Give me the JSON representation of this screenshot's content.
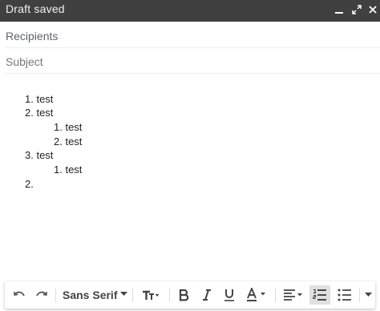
{
  "window": {
    "title": "Draft saved"
  },
  "fields": {
    "recipients_placeholder": "Recipients",
    "subject_placeholder": "Subject"
  },
  "body": {
    "items": [
      {
        "marker": "1.",
        "text": "test"
      },
      {
        "marker": "2.",
        "text": "test"
      },
      {
        "marker": "1.",
        "text": "test"
      },
      {
        "marker": "2.",
        "text": "test"
      },
      {
        "marker": "3.",
        "text": "test"
      },
      {
        "marker": "1.",
        "text": "test"
      },
      {
        "marker": "2.",
        "text": ""
      }
    ]
  },
  "toolbar": {
    "font_family": "Sans Serif",
    "active_button": "numbered-list",
    "icons": [
      "undo-icon",
      "redo-icon",
      "chevron-down-icon",
      "text-size-icon",
      "bold-icon",
      "italic-icon",
      "underline-icon",
      "text-color-icon",
      "align-icon",
      "numbered-list-icon",
      "bulleted-list-icon",
      "more-options-icon"
    ]
  },
  "colors": {
    "titlebar_bg": "#404040",
    "titlebar_text": "#f1f1f1",
    "icon": "#444444",
    "active_bg": "#e0e0e0"
  }
}
